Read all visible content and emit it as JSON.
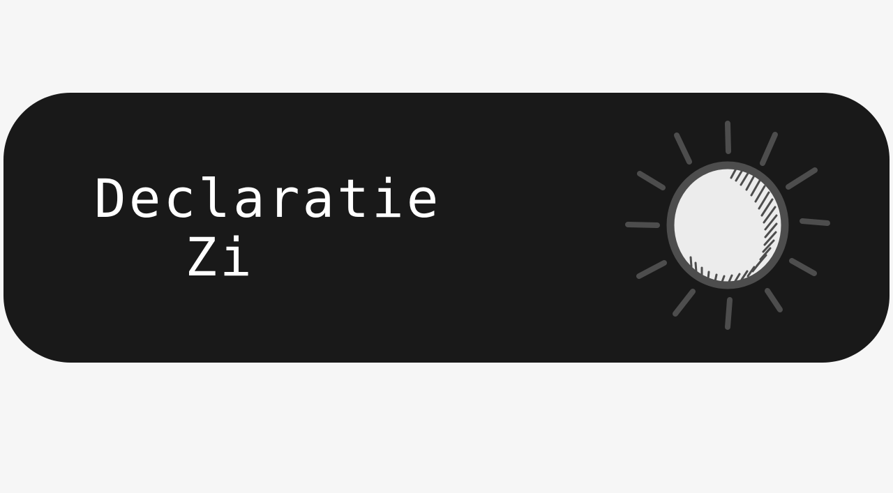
{
  "button": {
    "line1": "Declaratie",
    "line2": "Zi",
    "icon": "sun-icon"
  },
  "colors": {
    "page_background": "#f6f6f6",
    "button_background": "#191919",
    "text": "#ffffff",
    "icon_stroke": "#4d4d4d",
    "icon_fill": "#ececec"
  }
}
